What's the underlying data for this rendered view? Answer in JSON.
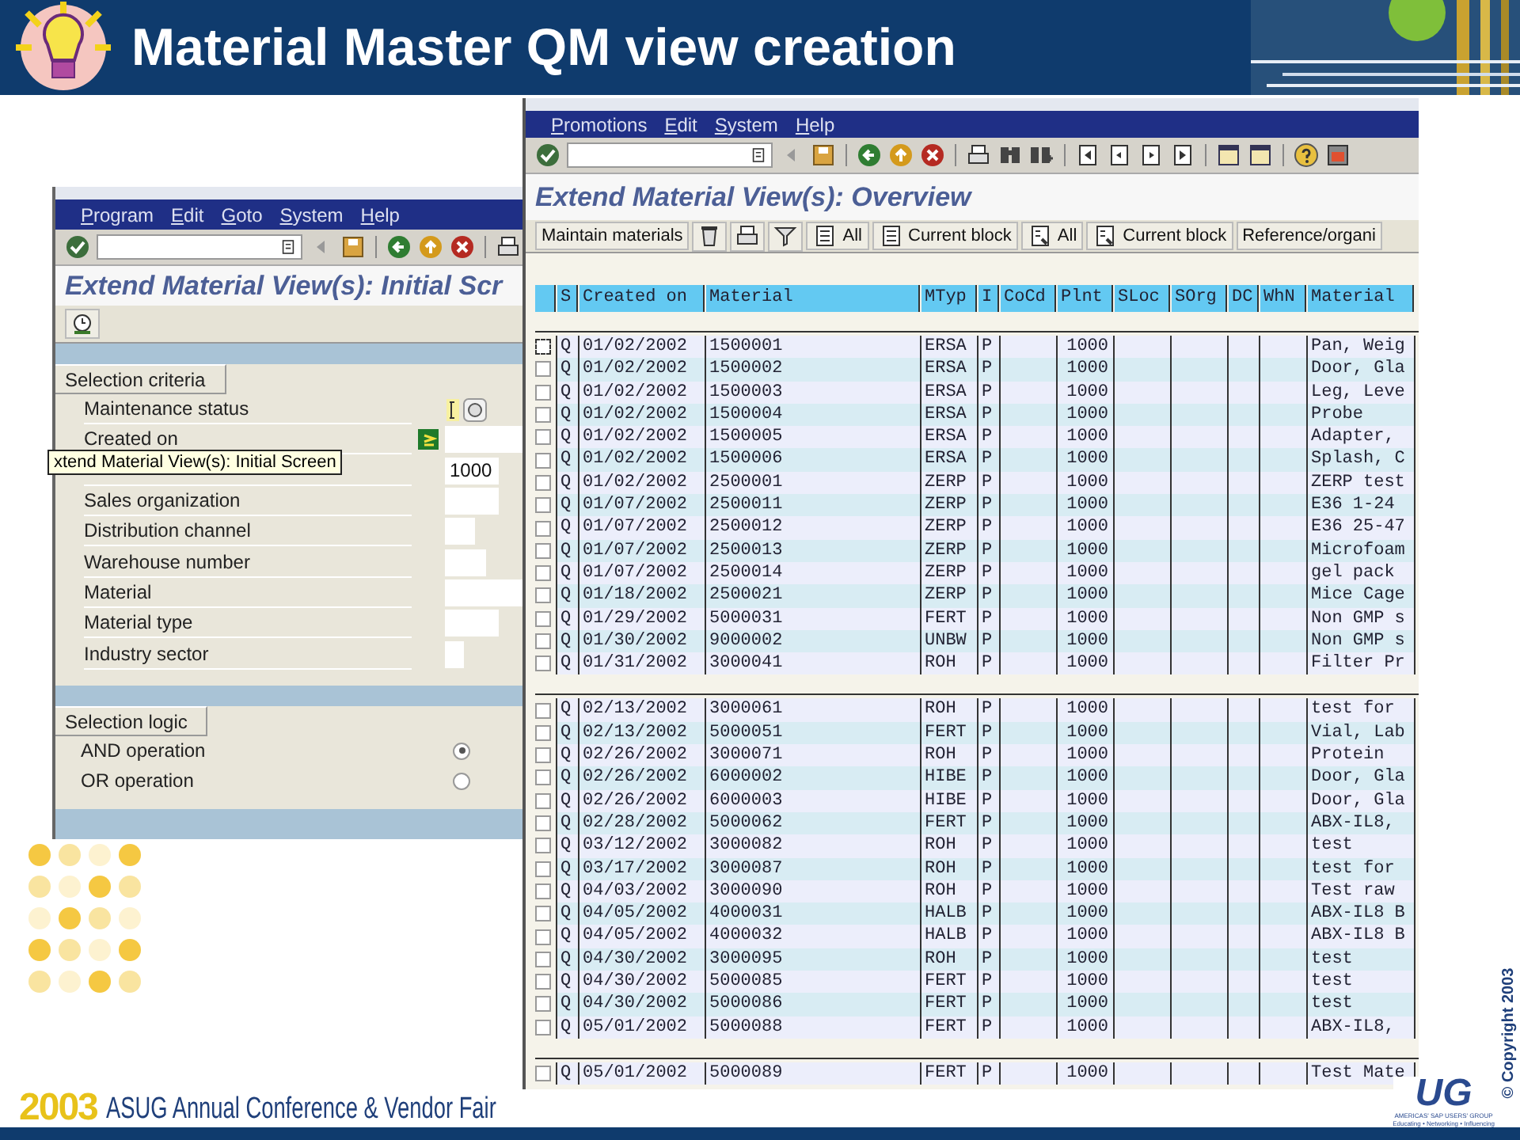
{
  "slide": {
    "title": "Material Master QM view creation",
    "footer": {
      "year": "2003",
      "event": "ASUG Annual Conference & Vendor Fair",
      "logo": "UG",
      "logo_tagline": "AMERICAS' SAP USERS' GROUP",
      "logo_motto": "Educating • Networking • Influencing",
      "copyright": "© Copyright 2003"
    }
  },
  "initial_screen": {
    "menu": [
      "Program",
      "Edit",
      "Goto",
      "System",
      "Help"
    ],
    "title": "Extend Material View(s): Initial Scr",
    "criteria": {
      "heading": "Selection criteria",
      "fields": [
        {
          "label": "Maintenance status",
          "kind": "status"
        },
        {
          "label": "Created on",
          "kind": "range"
        },
        {
          "kind": "input",
          "value": "1000"
        },
        {
          "label": "Sales organization",
          "kind": "input"
        },
        {
          "label": "Distribution channel",
          "kind": "input"
        },
        {
          "label": "Warehouse number",
          "kind": "input"
        },
        {
          "label": "Material",
          "kind": "input"
        },
        {
          "label": "Material type",
          "kind": "input"
        },
        {
          "label": "Industry sector",
          "kind": "input"
        }
      ]
    },
    "logic": {
      "heading": "Selection logic",
      "options": [
        {
          "label": "AND operation",
          "selected": true
        },
        {
          "label": "OR operation",
          "selected": false
        }
      ]
    },
    "tooltip": "xtend Material View(s): Initial Screen"
  },
  "overview": {
    "menu": [
      "Promotions",
      "Edit",
      "System",
      "Help"
    ],
    "title": "Extend Material View(s): Overview",
    "toolbar": [
      {
        "kind": "text",
        "label": "Maintain materials"
      },
      {
        "kind": "icon"
      },
      {
        "kind": "icon"
      },
      {
        "kind": "icon"
      },
      {
        "kind": "icon-text",
        "label": "All"
      },
      {
        "kind": "icon-text",
        "label": "Current block"
      },
      {
        "kind": "icon-text",
        "label": "All"
      },
      {
        "kind": "icon-text",
        "label": "Current block"
      },
      {
        "kind": "text",
        "label": "Reference/organi"
      }
    ],
    "table": {
      "columns": [
        "S",
        "Created on",
        "Material",
        "MTyp",
        "I",
        "CoCd",
        "Plnt",
        "SLoc",
        "SOrg",
        "DC",
        "WhN",
        "Material"
      ],
      "blocks": [
        {
          "rows": [
            {
              "checked": false,
              "s": "Q",
              "created": "01/02/2002",
              "material": "1500001",
              "mtyp": "ERSA",
              "i": "P",
              "plnt": "1000",
              "desc": "Pan, Weig"
            },
            {
              "checked": false,
              "s": "Q",
              "created": "01/02/2002",
              "material": "1500002",
              "mtyp": "ERSA",
              "i": "P",
              "plnt": "1000",
              "desc": "Door, Gla"
            },
            {
              "checked": false,
              "s": "Q",
              "created": "01/02/2002",
              "material": "1500003",
              "mtyp": "ERSA",
              "i": "P",
              "plnt": "1000",
              "desc": "Leg, Leve"
            },
            {
              "checked": false,
              "s": "Q",
              "created": "01/02/2002",
              "material": "1500004",
              "mtyp": "ERSA",
              "i": "P",
              "plnt": "1000",
              "desc": "Probe"
            },
            {
              "checked": false,
              "s": "Q",
              "created": "01/02/2002",
              "material": "1500005",
              "mtyp": "ERSA",
              "i": "P",
              "plnt": "1000",
              "desc": "Adapter,"
            },
            {
              "checked": false,
              "s": "Q",
              "created": "01/02/2002",
              "material": "1500006",
              "mtyp": "ERSA",
              "i": "P",
              "plnt": "1000",
              "desc": "Splash, C"
            },
            {
              "checked": false,
              "s": "Q",
              "created": "01/02/2002",
              "material": "2500001",
              "mtyp": "ZERP",
              "i": "P",
              "plnt": "1000",
              "desc": "ZERP test"
            },
            {
              "checked": false,
              "s": "Q",
              "created": "01/07/2002",
              "material": "2500011",
              "mtyp": "ZERP",
              "i": "P",
              "plnt": "1000",
              "desc": "E36 1-24"
            },
            {
              "checked": false,
              "s": "Q",
              "created": "01/07/2002",
              "material": "2500012",
              "mtyp": "ZERP",
              "i": "P",
              "plnt": "1000",
              "desc": "E36 25-47"
            },
            {
              "checked": false,
              "s": "Q",
              "created": "01/07/2002",
              "material": "2500013",
              "mtyp": "ZERP",
              "i": "P",
              "plnt": "1000",
              "desc": "Microfoam"
            },
            {
              "checked": false,
              "s": "Q",
              "created": "01/07/2002",
              "material": "2500014",
              "mtyp": "ZERP",
              "i": "P",
              "plnt": "1000",
              "desc": "gel pack"
            },
            {
              "checked": false,
              "s": "Q",
              "created": "01/18/2002",
              "material": "2500021",
              "mtyp": "ZERP",
              "i": "P",
              "plnt": "1000",
              "desc": "Mice Cage"
            },
            {
              "checked": false,
              "s": "Q",
              "created": "01/29/2002",
              "material": "5000031",
              "mtyp": "FERT",
              "i": "P",
              "plnt": "1000",
              "desc": "Non GMP s"
            },
            {
              "checked": false,
              "s": "Q",
              "created": "01/30/2002",
              "material": "9000002",
              "mtyp": "UNBW",
              "i": "P",
              "plnt": "1000",
              "desc": "Non GMP s"
            },
            {
              "checked": false,
              "s": "Q",
              "created": "01/31/2002",
              "material": "3000041",
              "mtyp": "ROH",
              "i": "P",
              "plnt": "1000",
              "desc": "Filter Pr"
            }
          ]
        },
        {
          "rows": [
            {
              "checked": false,
              "s": "Q",
              "created": "02/13/2002",
              "material": "3000061",
              "mtyp": "ROH",
              "i": "P",
              "plnt": "1000",
              "desc": "test for"
            },
            {
              "checked": false,
              "s": "Q",
              "created": "02/13/2002",
              "material": "5000051",
              "mtyp": "FERT",
              "i": "P",
              "plnt": "1000",
              "desc": "Vial, Lab"
            },
            {
              "checked": false,
              "s": "Q",
              "created": "02/26/2002",
              "material": "3000071",
              "mtyp": "ROH",
              "i": "P",
              "plnt": "1000",
              "desc": "Protein"
            },
            {
              "checked": false,
              "s": "Q",
              "created": "02/26/2002",
              "material": "6000002",
              "mtyp": "HIBE",
              "i": "P",
              "plnt": "1000",
              "desc": "Door, Gla"
            },
            {
              "checked": false,
              "s": "Q",
              "created": "02/26/2002",
              "material": "6000003",
              "mtyp": "HIBE",
              "i": "P",
              "plnt": "1000",
              "desc": "Door, Gla"
            },
            {
              "checked": false,
              "s": "Q",
              "created": "02/28/2002",
              "material": "5000062",
              "mtyp": "FERT",
              "i": "P",
              "plnt": "1000",
              "desc": "ABX-IL8,"
            },
            {
              "checked": false,
              "s": "Q",
              "created": "03/12/2002",
              "material": "3000082",
              "mtyp": "ROH",
              "i": "P",
              "plnt": "1000",
              "desc": "test"
            },
            {
              "checked": false,
              "s": "Q",
              "created": "03/17/2002",
              "material": "3000087",
              "mtyp": "ROH",
              "i": "P",
              "plnt": "1000",
              "desc": "test for"
            },
            {
              "checked": false,
              "s": "Q",
              "created": "04/03/2002",
              "material": "3000090",
              "mtyp": "ROH",
              "i": "P",
              "plnt": "1000",
              "desc": "Test raw"
            },
            {
              "checked": false,
              "s": "Q",
              "created": "04/05/2002",
              "material": "4000031",
              "mtyp": "HALB",
              "i": "P",
              "plnt": "1000",
              "desc": "ABX-IL8 B"
            },
            {
              "checked": false,
              "s": "Q",
              "created": "04/05/2002",
              "material": "4000032",
              "mtyp": "HALB",
              "i": "P",
              "plnt": "1000",
              "desc": "ABX-IL8 B"
            },
            {
              "checked": false,
              "s": "Q",
              "created": "04/30/2002",
              "material": "3000095",
              "mtyp": "ROH",
              "i": "P",
              "plnt": "1000",
              "desc": "test"
            },
            {
              "checked": false,
              "s": "Q",
              "created": "04/30/2002",
              "material": "5000085",
              "mtyp": "FERT",
              "i": "P",
              "plnt": "1000",
              "desc": "test"
            },
            {
              "checked": false,
              "s": "Q",
              "created": "04/30/2002",
              "material": "5000086",
              "mtyp": "FERT",
              "i": "P",
              "plnt": "1000",
              "desc": "test"
            },
            {
              "checked": false,
              "s": "Q",
              "created": "05/01/2002",
              "material": "5000088",
              "mtyp": "FERT",
              "i": "P",
              "plnt": "1000",
              "desc": "ABX-IL8,"
            }
          ]
        },
        {
          "rows": [
            {
              "checked": false,
              "s": "Q",
              "created": "05/01/2002",
              "material": "5000089",
              "mtyp": "FERT",
              "i": "P",
              "plnt": "1000",
              "desc": "Test Mate"
            }
          ]
        }
      ]
    }
  }
}
